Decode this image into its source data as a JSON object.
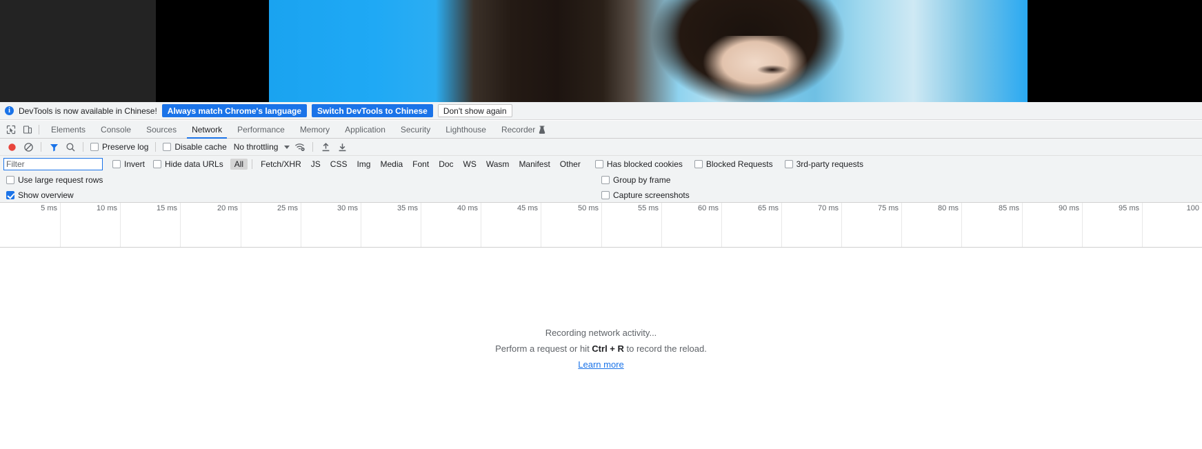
{
  "notice": {
    "icon": "info-icon",
    "message": "DevTools is now available in Chinese!",
    "primary_button": "Always match Chrome's language",
    "secondary_button": "Switch DevTools to Chinese",
    "dismiss_button": "Don't show again"
  },
  "tabbar": {
    "inspect_icon": "inspect-cursor-icon",
    "device_icon": "device-toolbar-icon",
    "tabs": [
      {
        "label": "Elements",
        "active": false
      },
      {
        "label": "Console",
        "active": false
      },
      {
        "label": "Sources",
        "active": false
      },
      {
        "label": "Network",
        "active": true
      },
      {
        "label": "Performance",
        "active": false
      },
      {
        "label": "Memory",
        "active": false
      },
      {
        "label": "Application",
        "active": false
      },
      {
        "label": "Security",
        "active": false
      },
      {
        "label": "Lighthouse",
        "active": false
      },
      {
        "label": "Recorder",
        "active": false,
        "icon": "recorder-flask-icon"
      }
    ]
  },
  "toolbar": {
    "record_icon": "record-button-icon",
    "clear_icon": "clear-network-log-icon",
    "filter_icon": "filter-funnel-icon",
    "search_icon": "search-icon",
    "preserve_log_label": "Preserve log",
    "preserve_log_checked": false,
    "disable_cache_label": "Disable cache",
    "disable_cache_checked": false,
    "throttling_value": "No throttling",
    "throttling_caret_icon": "chevron-down-icon",
    "network_conditions_icon": "wifi-settings-icon",
    "import_icon": "import-har-icon",
    "export_icon": "export-har-icon"
  },
  "filter": {
    "placeholder": "Filter",
    "value": "",
    "invert_label": "Invert",
    "invert_checked": false,
    "hide_data_urls_label": "Hide data URLs",
    "hide_data_urls_checked": false,
    "types": [
      {
        "label": "All",
        "selected": true
      },
      {
        "label": "Fetch/XHR",
        "selected": false
      },
      {
        "label": "JS",
        "selected": false
      },
      {
        "label": "CSS",
        "selected": false
      },
      {
        "label": "Img",
        "selected": false
      },
      {
        "label": "Media",
        "selected": false
      },
      {
        "label": "Font",
        "selected": false
      },
      {
        "label": "Doc",
        "selected": false
      },
      {
        "label": "WS",
        "selected": false
      },
      {
        "label": "Wasm",
        "selected": false
      },
      {
        "label": "Manifest",
        "selected": false
      },
      {
        "label": "Other",
        "selected": false
      }
    ],
    "has_blocked_cookies_label": "Has blocked cookies",
    "has_blocked_cookies_checked": false,
    "blocked_requests_label": "Blocked Requests",
    "blocked_requests_checked": false,
    "third_party_label": "3rd-party requests",
    "third_party_checked": false
  },
  "settings": {
    "use_large_request_rows_label": "Use large request rows",
    "use_large_request_rows_checked": false,
    "show_overview_label": "Show overview",
    "show_overview_checked": true,
    "group_by_frame_label": "Group by frame",
    "group_by_frame_checked": false,
    "capture_screenshots_label": "Capture screenshots",
    "capture_screenshots_checked": false
  },
  "overview": {
    "tick_labels": [
      "5 ms",
      "10 ms",
      "15 ms",
      "20 ms",
      "25 ms",
      "30 ms",
      "35 ms",
      "40 ms",
      "45 ms",
      "50 ms",
      "55 ms",
      "60 ms",
      "65 ms",
      "70 ms",
      "75 ms",
      "80 ms",
      "85 ms",
      "90 ms",
      "95 ms",
      "100"
    ]
  },
  "empty_state": {
    "title": "Recording network activity...",
    "subtitle_prefix": "Perform a request or hit ",
    "shortcut": "Ctrl + R",
    "subtitle_suffix": " to record the reload.",
    "link": "Learn more"
  },
  "colors": {
    "accent": "#1a73e8",
    "record_red": "#e8453c",
    "toolbar_bg": "#f1f3f4",
    "text": "#202124",
    "muted": "#5f6368"
  }
}
